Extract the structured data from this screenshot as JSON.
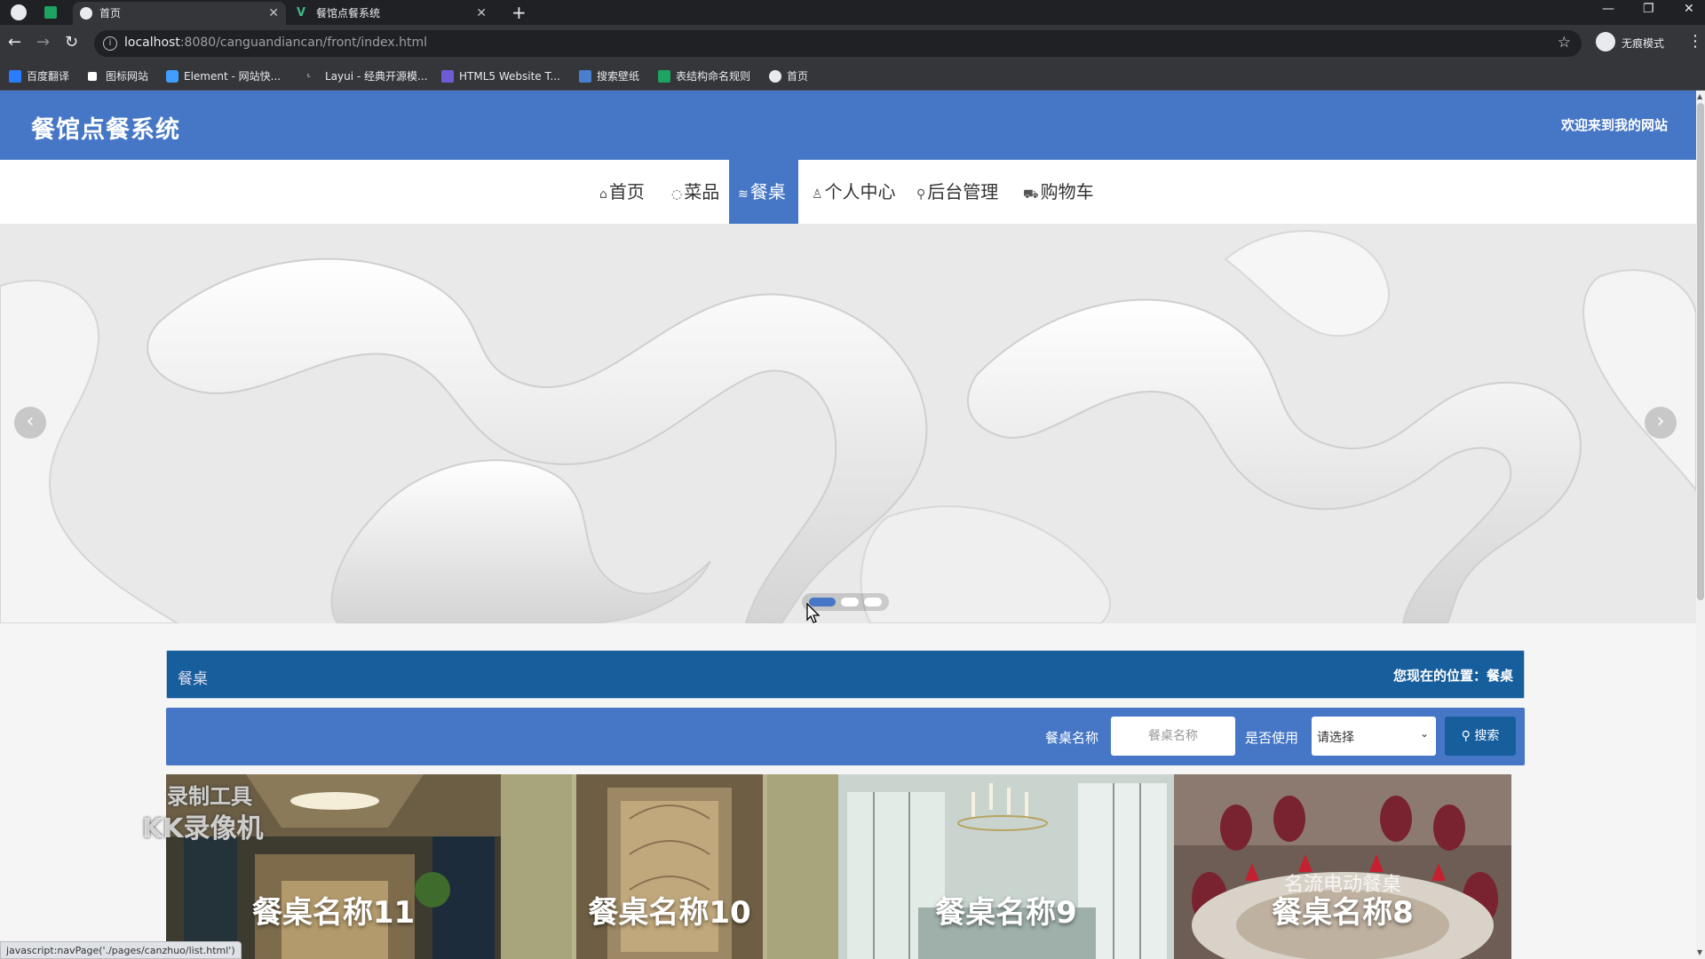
{
  "browser": {
    "tabs": [
      {
        "title": "首页",
        "active": true
      },
      {
        "title": "餐馆点餐系统",
        "active": false
      }
    ],
    "url_host": "localhost",
    "url_path": ":8080/canguandiancan/front/index.html",
    "incognito_label": "无痕模式",
    "bookmarks": [
      {
        "label": "百度翻译",
        "icon": "baidu-translate-icon",
        "color": "#2b7cff"
      },
      {
        "label": "图标网站",
        "icon": "flag-icon",
        "color": "#ffffff"
      },
      {
        "label": "Element - 网站快...",
        "icon": "element-hexagon-icon",
        "color": "#409eff"
      },
      {
        "label": "Layui - 经典开源模...",
        "icon": "layui-icon",
        "color": "#ffffff"
      },
      {
        "label": "HTML5 Website T...",
        "icon": "html5-shield-icon",
        "color": "#6f5bd6"
      },
      {
        "label": "搜索壁纸",
        "icon": "wallhaven-icon",
        "color": "#4a7fd0"
      },
      {
        "label": "表结构命名规则",
        "icon": "sheet-icon",
        "color": "#1ea362"
      },
      {
        "label": "首页",
        "icon": "globe-icon",
        "color": "#e8eaed"
      }
    ]
  },
  "site": {
    "title": "餐馆点餐系统",
    "welcome": "欢迎来到我的网站",
    "primary_color": "#4677c6",
    "dark_color": "#175e9d"
  },
  "nav": [
    {
      "label": "首页",
      "icon": "⌂",
      "active": false
    },
    {
      "label": "菜品",
      "icon": "◌",
      "active": false
    },
    {
      "label": "餐桌",
      "icon": "≋",
      "active": true
    },
    {
      "label": "个人中心",
      "icon": "♙",
      "active": false
    },
    {
      "label": "后台管理",
      "icon": "⚲",
      "active": false
    },
    {
      "label": "购物车",
      "icon": "⛟",
      "active": false
    }
  ],
  "carousel": {
    "slide_count": 3,
    "active_index": 0
  },
  "section": {
    "title": "餐桌",
    "breadcrumb": "您现在的位置：餐桌"
  },
  "search": {
    "name_label": "餐桌名称",
    "name_placeholder": "餐桌名称",
    "used_label": "是否使用",
    "used_select_value": "请选择",
    "button_label": "搜索"
  },
  "cards": [
    {
      "title": "餐桌名称11",
      "image": "restaurant-interior-photo"
    },
    {
      "title": "餐桌名称10",
      "image": "decorative-door-photo"
    },
    {
      "title": "餐桌名称9",
      "image": "dining-room-photo"
    },
    {
      "title": "餐桌名称8",
      "image": "round-banquet-table-photo",
      "overlay_text": "名流电动餐桌"
    }
  ],
  "watermark": {
    "line1": "录制工具",
    "line2": "KK录像机"
  },
  "status_bar_url": "javascript:navPage('./pages/canzhuo/list.html')"
}
